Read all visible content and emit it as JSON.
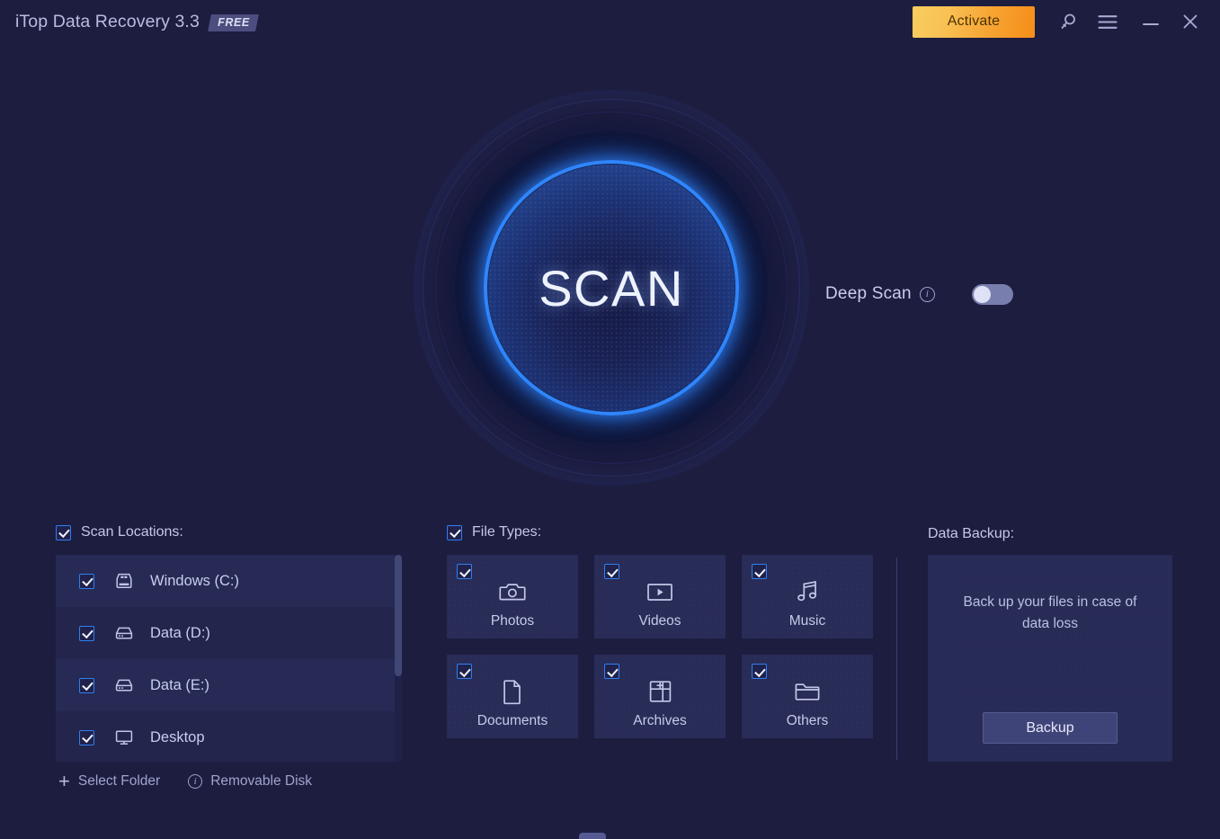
{
  "titlebar": {
    "app_title": "iTop Data Recovery 3.3",
    "edition_badge": "FREE",
    "activate_label": "Activate",
    "search_icon": "search-key-icon",
    "menu_icon": "hamburger-menu-icon",
    "minimize_icon": "minimize-icon",
    "close_icon": "close-icon"
  },
  "scan": {
    "button_label": "SCAN",
    "deep_scan_label": "Deep Scan",
    "deep_scan_info_icon": "info-icon",
    "deep_scan_enabled": "off"
  },
  "scan_locations": {
    "title": "Scan Locations:",
    "checked": true,
    "items": [
      {
        "label": "Windows (C:)",
        "icon": "windows-drive-icon",
        "checked": true
      },
      {
        "label": "Data (D:)",
        "icon": "hard-drive-icon",
        "checked": true
      },
      {
        "label": "Data (E:)",
        "icon": "hard-drive-icon",
        "checked": true
      },
      {
        "label": "Desktop",
        "icon": "monitor-icon",
        "checked": true
      }
    ],
    "links": [
      {
        "label": "Select Folder",
        "icon": "plus-icon"
      },
      {
        "label": "Removable Disk",
        "icon": "info-icon"
      }
    ]
  },
  "file_types": {
    "title": "File Types:",
    "checked": true,
    "items": [
      {
        "label": "Photos",
        "icon": "camera-icon",
        "checked": true
      },
      {
        "label": "Videos",
        "icon": "video-player-icon",
        "checked": true
      },
      {
        "label": "Music",
        "icon": "music-note-icon",
        "checked": true
      },
      {
        "label": "Documents",
        "icon": "document-page-icon",
        "checked": true
      },
      {
        "label": "Archives",
        "icon": "archive-box-icon",
        "checked": true
      },
      {
        "label": "Others",
        "icon": "folder-icon",
        "checked": true
      }
    ]
  },
  "data_backup": {
    "title": "Data Backup:",
    "description": "Back up your files in case of data loss",
    "button_label": "Backup"
  },
  "colors": {
    "background": "#1d1d40",
    "panel": "#272b56",
    "accent_blue": "#2f85fb",
    "checkbox_border": "#2f7ff2",
    "activate_gradient_start": "#f8cd5f",
    "activate_gradient_end": "#f58d18",
    "text_primary": "#c9cdee",
    "text_muted": "#9fa4cd"
  }
}
